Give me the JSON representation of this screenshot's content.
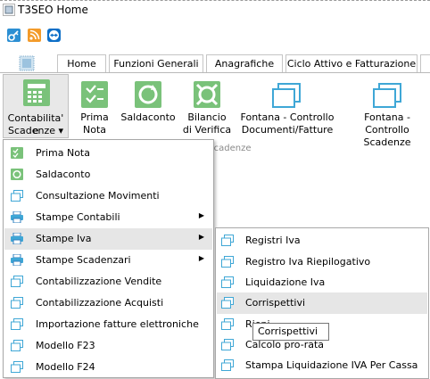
{
  "window": {
    "title": "T3SEO Home"
  },
  "quick_access": [
    "key-icon",
    "rss-icon",
    "teamviewer-icon"
  ],
  "tabs": [
    "Home",
    "Funzioni Generali",
    "Anagrafiche",
    "Ciclo Attivo e Fatturazione"
  ],
  "ribbon": {
    "buttons": [
      {
        "label1": "Contabilita' e",
        "label2": "Scadenze ▾",
        "icon": "calculator-icon"
      },
      {
        "label1": "Prima",
        "label2": "Nota",
        "icon": "prima-nota-icon"
      },
      {
        "label1": "Saldaconto",
        "label2": "",
        "icon": "saldaconto-icon"
      },
      {
        "label1": "Bilancio",
        "label2": "di Verifica",
        "icon": "bilancio-icon"
      },
      {
        "label1": "Fontana - Controllo",
        "label2": "Documenti/Fatture",
        "icon": "window-icon"
      },
      {
        "label1": "Fontana -",
        "label2": "Controllo Scadenze",
        "icon": "window-icon"
      }
    ],
    "group_label": "e Scadenze"
  },
  "menu": {
    "items": [
      {
        "label": "Prima Nota",
        "icon": "prima-nota-icon",
        "submenu": false
      },
      {
        "label": "Saldaconto",
        "icon": "saldaconto-icon",
        "submenu": false
      },
      {
        "label": "Consultazione Movimenti",
        "icon": "window-icon",
        "submenu": false
      },
      {
        "label": "Stampe Contabili",
        "icon": "printer-icon",
        "submenu": true
      },
      {
        "label": "Stampe Iva",
        "icon": "printer-icon",
        "submenu": true
      },
      {
        "label": "Stampe Scadenzari",
        "icon": "printer-icon",
        "submenu": true
      },
      {
        "label": "Contabilizzazione Vendite",
        "icon": "window-icon",
        "submenu": false
      },
      {
        "label": "Contabilizzazione Acquisti",
        "icon": "window-icon",
        "submenu": false
      },
      {
        "label": "Importazione fatture elettroniche",
        "icon": "window-icon",
        "submenu": false
      },
      {
        "label": "Modello F23",
        "icon": "window-icon",
        "submenu": false
      },
      {
        "label": "Modello F24",
        "icon": "window-icon",
        "submenu": false
      }
    ],
    "highlighted": "Stampe Iva"
  },
  "submenu": {
    "items": [
      "Registri Iva",
      "Registro Iva Riepilogativo",
      "Liquidazione Iva",
      "Corrispettivi",
      "Riepi",
      "Calcolo pro-rata",
      "Stampa Liquidazione IVA Per Cassa"
    ],
    "highlighted": "Corrispettivi"
  },
  "tooltip": "Corrispettivi",
  "colors": {
    "green_icon": "#7ac27a",
    "blue_icon": "#3fa7d6",
    "highlight": "#e6e6e6"
  }
}
